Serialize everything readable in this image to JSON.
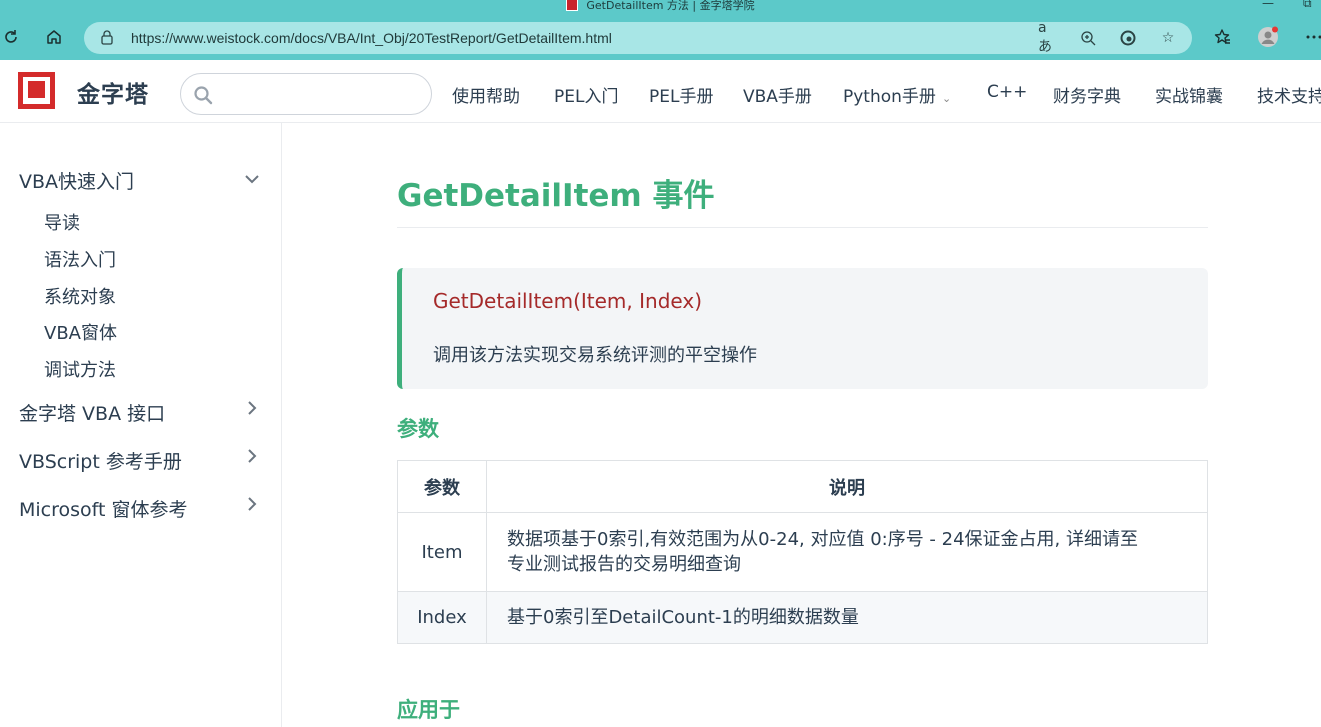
{
  "browser": {
    "window_title": "GetDetailItem 方法 | 金字塔学院",
    "url": "https://www.weistock.com/docs/VBA/Int_Obj/20TestReport/GetDetailItem.html",
    "window_controls": {
      "minimize": "—",
      "restore": "⧉"
    },
    "address_actions": {
      "read_aloud": "aあ",
      "zoom": "⊕",
      "refresh_tab": "⟳",
      "favorite": "☆"
    },
    "toolbar_icons": [
      "refresh-icon",
      "home-icon",
      "lock-icon",
      "collections-icon",
      "profile-icon",
      "more-icon"
    ]
  },
  "header": {
    "brand": "金字塔",
    "search_placeholder": "",
    "nav": [
      {
        "label": "使用帮助"
      },
      {
        "label": "PEL入门"
      },
      {
        "label": "PEL手册"
      },
      {
        "label": "VBA手册"
      },
      {
        "label": "Python手册",
        "has_dropdown": true
      },
      {
        "label": "C++"
      },
      {
        "label": "财务字典"
      },
      {
        "label": "实战锦囊"
      },
      {
        "label": "技术支持"
      }
    ]
  },
  "sidebar": {
    "groups": [
      {
        "label": "VBA快速入门",
        "expanded": true,
        "items": [
          "导读",
          "语法入门",
          "系统对象",
          "VBA窗体",
          "调试方法"
        ]
      },
      {
        "label": "金字塔 VBA 接口",
        "expanded": false
      },
      {
        "label": "VBScript 参考手册",
        "expanded": false
      },
      {
        "label": "Microsoft 窗体参考",
        "expanded": false
      }
    ]
  },
  "content": {
    "title": "GetDetailItem 事件",
    "signature": "GetDetailItem(Item, Index)",
    "description": "调用该方法实现交易系统评测的平空操作",
    "params_heading": "参数",
    "table": {
      "headers": [
        "参数",
        "说明"
      ],
      "rows": [
        {
          "name": "Item",
          "desc_line1": "数据项基于0索引,有效范围为从0-24, 对应值 0:序号 - 24保证金占用, 详细请至",
          "desc_line2": "专业测试报告的交易明细查询"
        },
        {
          "name": "Index",
          "desc_line1": "基于0索引至DetailCount-1的明细数据数量"
        }
      ]
    },
    "applies_heading": "应用于"
  },
  "colors": {
    "accent": "#3eaf7c",
    "signature": "#a52a2a",
    "chrome": "#5cc9c9",
    "address_bar": "#a8e6e6",
    "logo": "#d42b2b"
  }
}
